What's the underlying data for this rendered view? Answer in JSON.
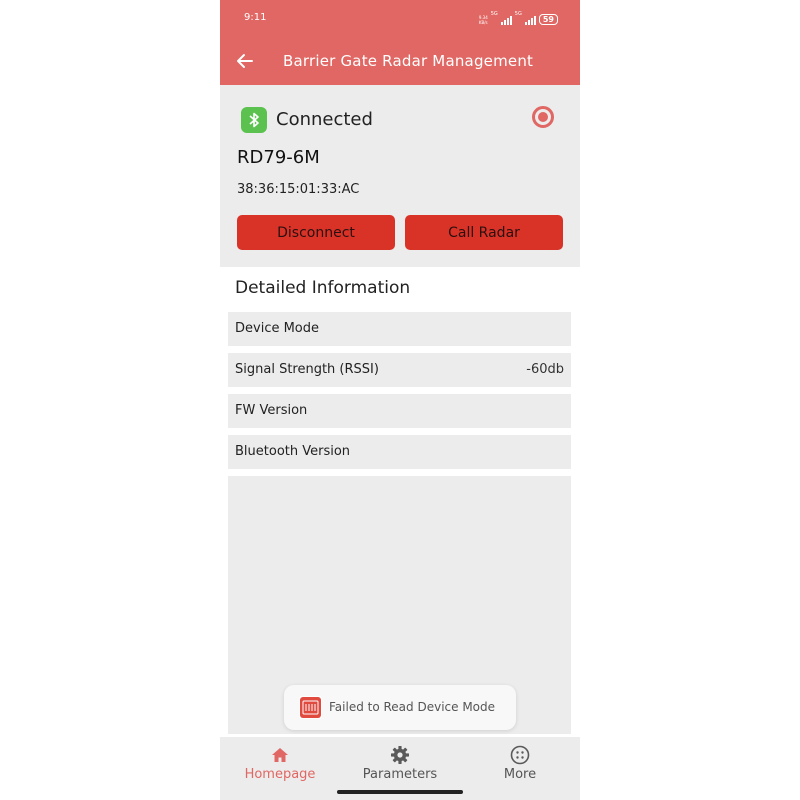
{
  "status_bar": {
    "time": "9:11",
    "net_speed_top": "9.34",
    "net_speed_bottom": "KB/s",
    "sim1_tag": "5G",
    "sim2_tag": "5G",
    "battery": "59"
  },
  "header": {
    "title": "Barrier Gate Radar Management",
    "back_icon": "back-arrow-icon"
  },
  "device": {
    "status": "Connected",
    "status_icon": "bluetooth-icon",
    "name": "RD79-6M",
    "mac": "38:36:15:01:33:AC",
    "disconnect_label": "Disconnect",
    "call_label": "Call Radar"
  },
  "details": {
    "title": "Detailed Information",
    "rows": [
      {
        "label": "Device Mode",
        "value": ""
      },
      {
        "label": "Signal Strength (RSSI)",
        "value": "-60db"
      },
      {
        "label": "FW Version",
        "value": ""
      },
      {
        "label": "Bluetooth Version",
        "value": ""
      }
    ]
  },
  "toast": {
    "message": "Failed to Read Device Mode"
  },
  "nav": {
    "items": [
      {
        "label": "Homepage",
        "icon": "home-icon",
        "active": true
      },
      {
        "label": "Parameters",
        "icon": "gear-icon",
        "active": false
      },
      {
        "label": "More",
        "icon": "more-icon",
        "active": false
      }
    ]
  },
  "colors": {
    "brand": "#e06763",
    "button": "#d93328",
    "bluetooth": "#5bc24f"
  }
}
